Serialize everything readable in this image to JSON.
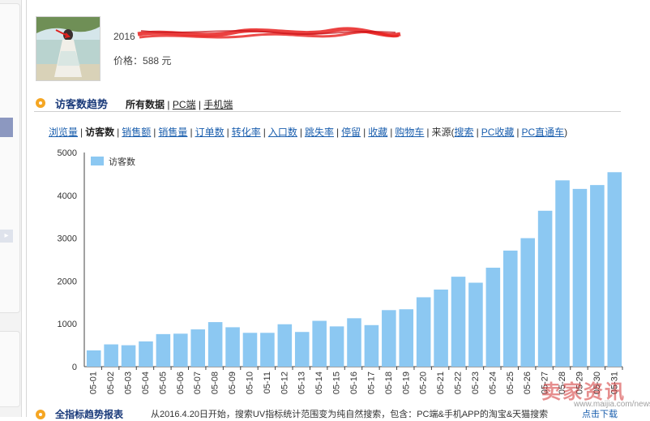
{
  "product": {
    "title_visible": "2016",
    "price_label": "价格：",
    "price_value": "588 元"
  },
  "section": {
    "title": "访客数趋势",
    "tabs": [
      {
        "label": "所有数据",
        "active": true
      },
      {
        "label": "PC端",
        "active": false
      },
      {
        "label": "手机端",
        "active": false
      }
    ]
  },
  "metrics": {
    "items": [
      "浏览量",
      "访客数",
      "销售额",
      "销售量",
      "订单数",
      "转化率",
      "入口数",
      "跳失率",
      "停留",
      "收藏",
      "购物车"
    ],
    "active": "访客数",
    "source_label": "来源(",
    "source_items": [
      "搜索",
      "PC收藏",
      "PC直通车"
    ],
    "source_close": ")"
  },
  "chart_data": {
    "type": "bar",
    "categories": [
      "05-01",
      "05-02",
      "05-03",
      "05-04",
      "05-05",
      "05-06",
      "05-07",
      "05-08",
      "05-09",
      "05-10",
      "05-11",
      "05-12",
      "05-13",
      "05-14",
      "05-15",
      "05-16",
      "05-17",
      "05-18",
      "05-19",
      "05-20",
      "05-21",
      "05-22",
      "05-23",
      "05-24",
      "05-25",
      "05-26",
      "05-27",
      "05-28",
      "05-29",
      "05-30",
      "05-31"
    ],
    "series": [
      {
        "name": "访客数",
        "values": [
          380,
          520,
          500,
          590,
          760,
          770,
          870,
          1040,
          920,
          790,
          790,
          990,
          810,
          1070,
          940,
          1130,
          970,
          1320,
          1340,
          1620,
          1800,
          2100,
          1960,
          2310,
          2710,
          3000,
          3640,
          4350,
          4150,
          4240,
          4540
        ]
      }
    ],
    "ylim": [
      0,
      5000
    ],
    "yticks": [
      0,
      1000,
      2000,
      3000,
      4000,
      5000
    ],
    "color": "#8cc8f2",
    "legend": "top-left",
    "grid": false
  },
  "bottom": {
    "title": "全指标趋势报表",
    "desc": "从2016.4.20日开始，搜索UV指标统计范围变为纯自然搜索，包含：PC端&手机APP的淘宝&天猫搜索",
    "link": "点击下载"
  },
  "watermark": {
    "main": "卖家资讯",
    "site": "www.maijia.com/news"
  }
}
